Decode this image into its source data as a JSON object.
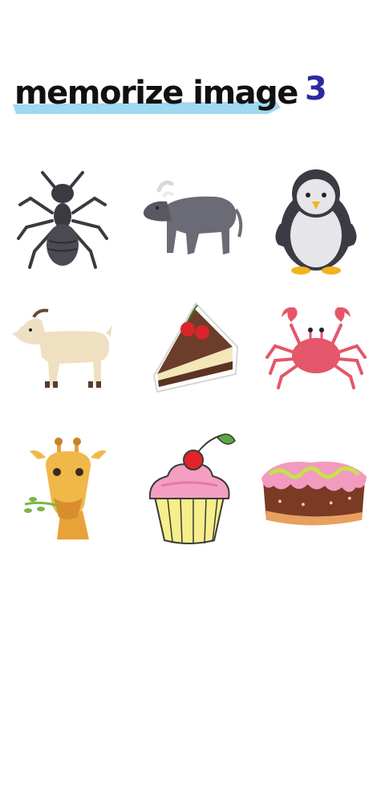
{
  "header": {
    "title": "memorize image",
    "counter": "3"
  },
  "colors": {
    "highlight": "#8fd0ee",
    "counter": "#2a2a9e"
  },
  "grid": {
    "items": [
      {
        "name": "ant",
        "icon": "ant-icon"
      },
      {
        "name": "buffalo",
        "icon": "buffalo-icon"
      },
      {
        "name": "penguin",
        "icon": "penguin-icon"
      },
      {
        "name": "goat",
        "icon": "goat-icon"
      },
      {
        "name": "cake-slice",
        "icon": "cake-slice-icon"
      },
      {
        "name": "crab",
        "icon": "crab-icon"
      },
      {
        "name": "giraffe",
        "icon": "giraffe-icon"
      },
      {
        "name": "cupcake",
        "icon": "cupcake-icon"
      },
      {
        "name": "cake",
        "icon": "cake-icon"
      }
    ]
  }
}
